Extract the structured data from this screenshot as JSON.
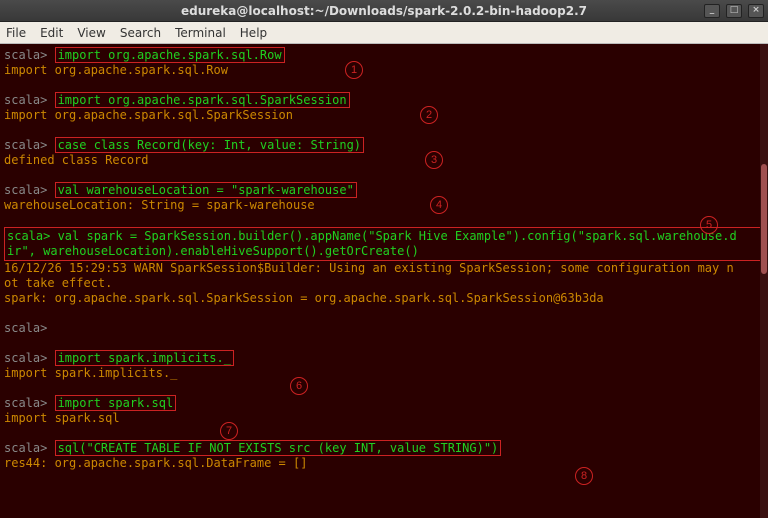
{
  "window": {
    "title": "edureka@localhost:~/Downloads/spark-2.0.2-bin-hadoop2.7",
    "controls": {
      "min": "_",
      "max": "□",
      "close": "×"
    }
  },
  "menubar": [
    "File",
    "Edit",
    "View",
    "Search",
    "Terminal",
    "Help"
  ],
  "prompt": "scala> ",
  "cmds": {
    "c1": "import org.apache.spark.sql.Row",
    "r1": "import org.apache.spark.sql.Row",
    "c2": "import org.apache.spark.sql.SparkSession",
    "r2": "import org.apache.spark.sql.SparkSession",
    "c3": "case class Record(key: Int, value: String)",
    "r3": "defined class Record",
    "c4": "val warehouseLocation = \"spark-warehouse\"",
    "r4": "warehouseLocation: String = spark-warehouse",
    "c5a": "scala> val spark = SparkSession.builder().appName(\"Spark Hive Example\").config(\"spark.sql.warehouse.d",
    "c5b": "ir\", warehouseLocation).enableHiveSupport().getOrCreate()",
    "r5a": "16/12/26 15:29:53 WARN SparkSession$Builder: Using an existing SparkSession; some configuration may n",
    "r5b": "ot take effect.",
    "r5c": "spark: org.apache.spark.sql.SparkSession = org.apache.spark.sql.SparkSession@63b3da",
    "c6": "import spark.implicits._",
    "r6": "import spark.implicits._",
    "c7": "import spark.sql",
    "r7": "import spark.sql",
    "c8": "sql(\"CREATE TABLE IF NOT EXISTS src (key INT, value STRING)\")",
    "r8": "res44: org.apache.spark.sql.DataFrame = []"
  },
  "badges": [
    "1",
    "2",
    "3",
    "4",
    "5",
    "6",
    "7",
    "8"
  ]
}
